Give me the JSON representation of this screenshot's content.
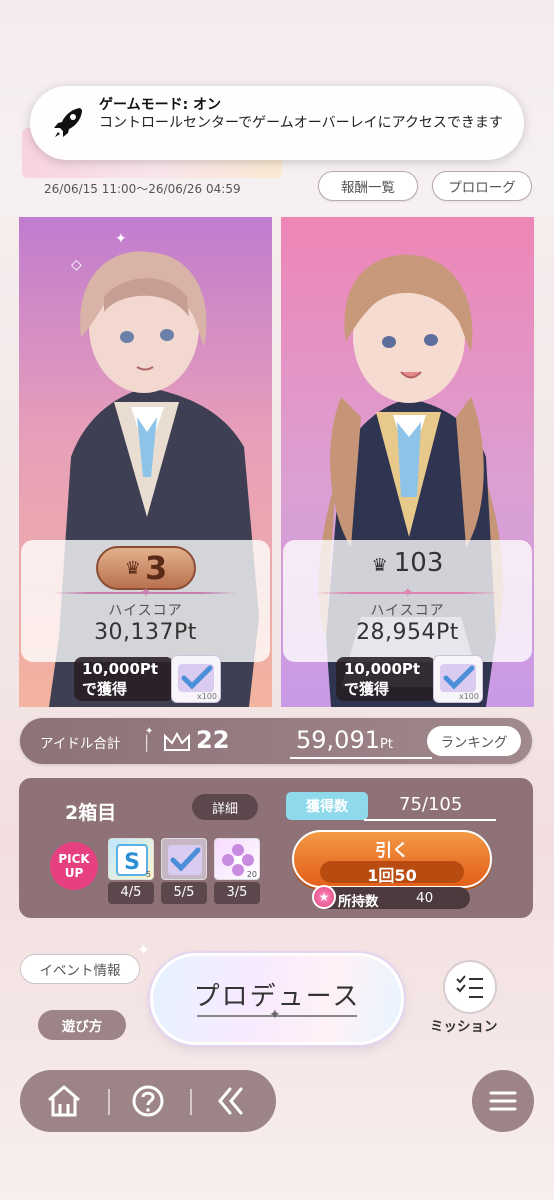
{
  "notification": {
    "icon": "rocket-icon",
    "title": "ゲームモード: オン",
    "message": "コントロールセンターでゲームオーバーレイにアクセスできます"
  },
  "event": {
    "period": "26/06/15 11:00～26/06/26 04:59",
    "rewards_button": "報酬一覧",
    "prologue_button": "プロローグ"
  },
  "idols": [
    {
      "rank": "3",
      "score_label": "ハイスコア",
      "score": "30,137Pt",
      "reward_label_line1": "10,000Pt",
      "reward_label_line2": "で獲得",
      "reward_count": "x100"
    },
    {
      "rank": "103",
      "score_label": "ハイスコア",
      "score": "28,954Pt",
      "reward_label_line1": "10,000Pt",
      "reward_label_line2": "で獲得",
      "reward_count": "x100"
    }
  ],
  "idol_total": {
    "label": "アイドル合計",
    "rank": "22",
    "points": "59,091",
    "points_unit": "Pt",
    "ranking_button": "ランキング"
  },
  "gacha": {
    "box_label": "2箱目",
    "detail_button": "詳細",
    "acquired_label": "獲得数",
    "acquired_value": "75/105",
    "pickup_line1": "PICK",
    "pickup_line2": "UP",
    "prizes": [
      {
        "count": "4/5",
        "badge": "5"
      },
      {
        "count": "5/5",
        "badge": ""
      },
      {
        "count": "3/5",
        "badge": "20"
      }
    ],
    "draw_label": "引く",
    "draw_cost": "1回50",
    "owned_label": "所持数",
    "owned_value": "40"
  },
  "bottom": {
    "event_info": "イベント情報",
    "how_to_play": "遊び方",
    "produce": "プロデュース",
    "mission": "ミッション"
  },
  "colors": {
    "accent_orange": "#ea7a2e",
    "pickup_pink": "#e74081",
    "panel_mauve": "#8e7277",
    "acquired_cyan": "#8fd9ec"
  }
}
